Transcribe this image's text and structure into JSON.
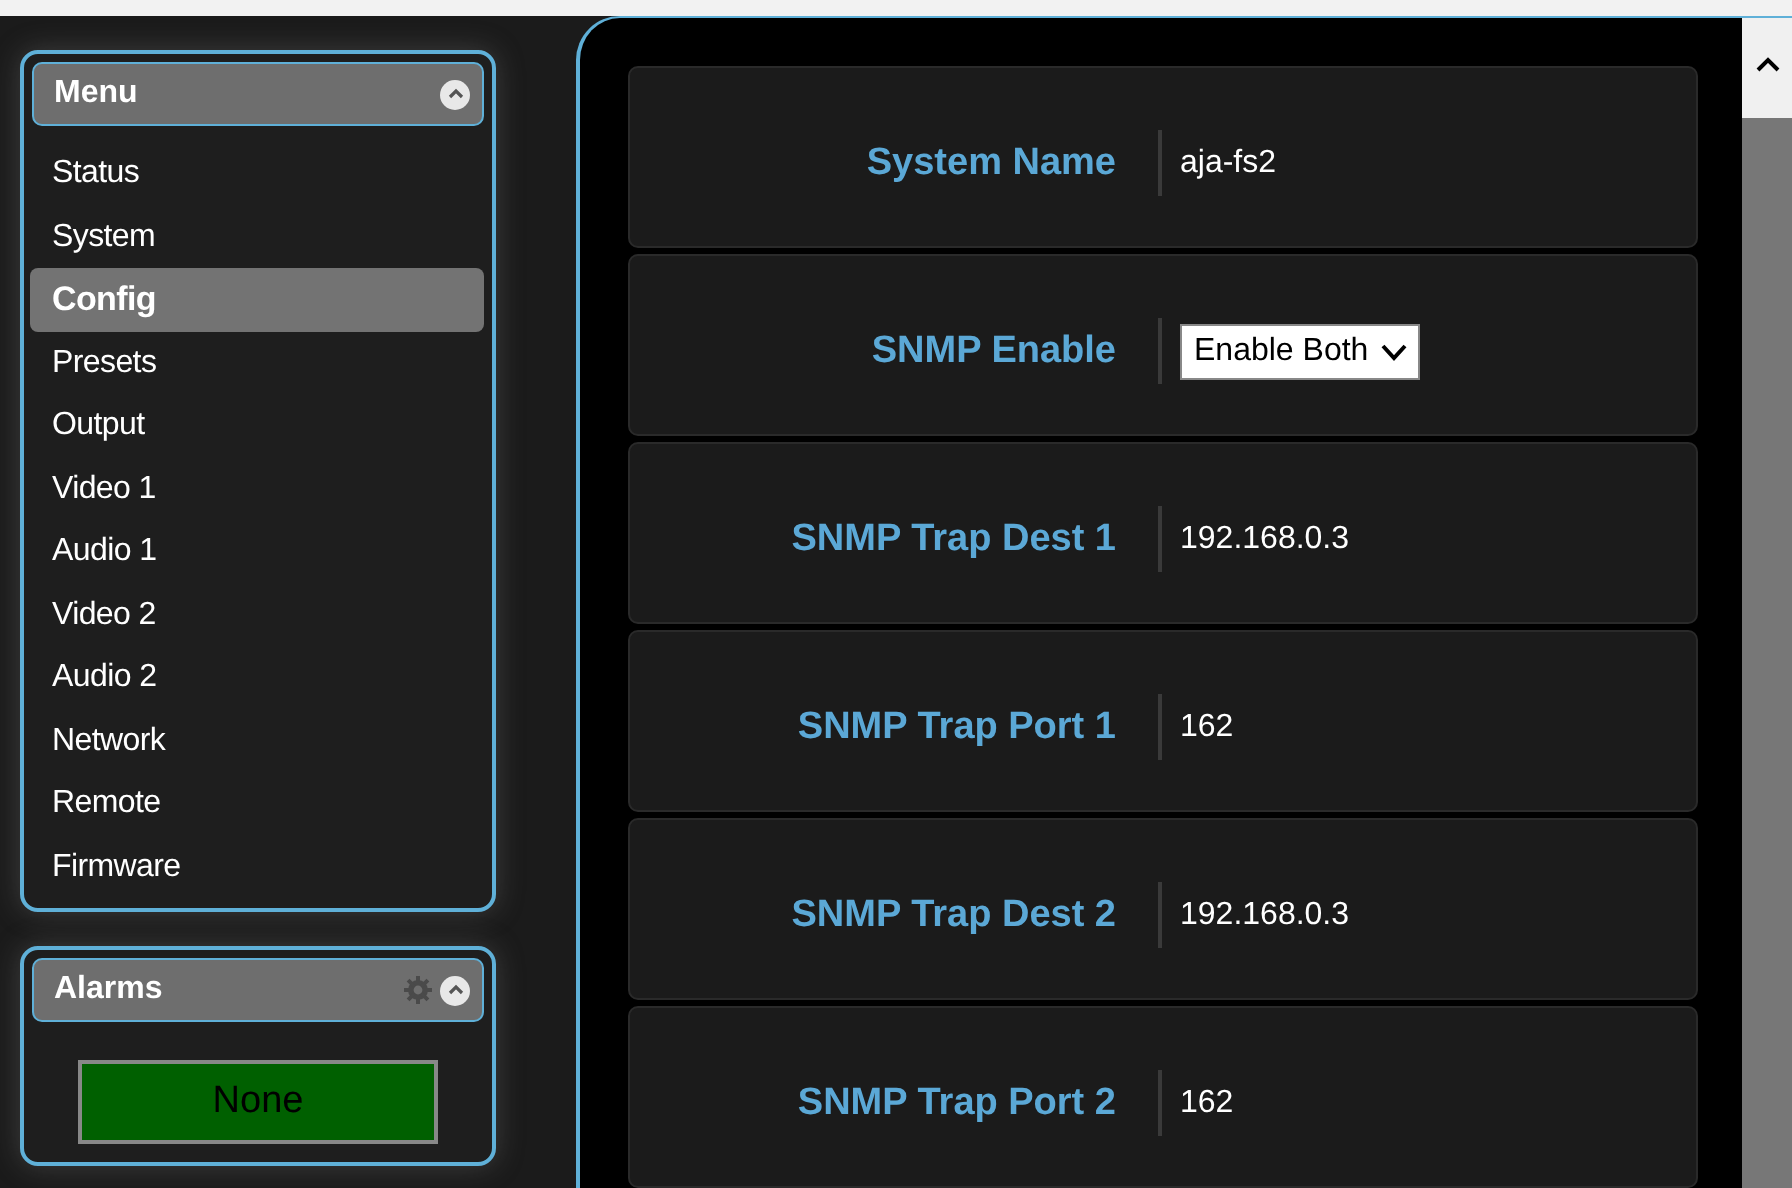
{
  "menu": {
    "title": "Menu",
    "items": [
      {
        "label": "Status",
        "selected": false
      },
      {
        "label": "System",
        "selected": false
      },
      {
        "label": "Config",
        "selected": true
      },
      {
        "label": "Presets",
        "selected": false
      },
      {
        "label": "Output",
        "selected": false
      },
      {
        "label": "Video 1",
        "selected": false
      },
      {
        "label": "Audio 1",
        "selected": false
      },
      {
        "label": "Video 2",
        "selected": false
      },
      {
        "label": "Audio 2",
        "selected": false
      },
      {
        "label": "Network",
        "selected": false
      },
      {
        "label": "Remote",
        "selected": false
      },
      {
        "label": "Firmware",
        "selected": false
      }
    ]
  },
  "alarms": {
    "title": "Alarms",
    "status": "None"
  },
  "settings": [
    {
      "kind": "text",
      "label": "System Name",
      "value": "aja-fs2"
    },
    {
      "kind": "select",
      "label": "SNMP Enable",
      "value": "Enable Both"
    },
    {
      "kind": "text",
      "label": "SNMP Trap Dest 1",
      "value": "192.168.0.3"
    },
    {
      "kind": "text",
      "label": "SNMP Trap Port 1",
      "value": "162"
    },
    {
      "kind": "text",
      "label": "SNMP Trap Dest 2",
      "value": "192.168.0.3"
    },
    {
      "kind": "text",
      "label": "SNMP Trap Port 2",
      "value": "162"
    }
  ]
}
